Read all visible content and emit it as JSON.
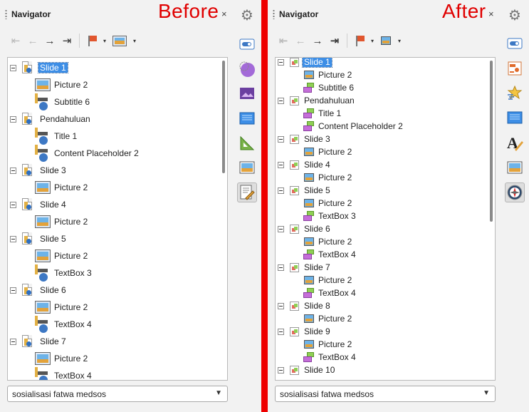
{
  "before": {
    "title": "Navigator",
    "tag": "Before",
    "close": "×",
    "toolbar": {
      "first": "⇤",
      "prev": "←",
      "next": "→",
      "last": "⇥",
      "drop": "▾"
    },
    "tree": [
      {
        "label": "Slide 1",
        "selected": true
      },
      {
        "label": "Picture 2"
      },
      {
        "label": "Subtitle 6"
      },
      {
        "label": "Pendahuluan"
      },
      {
        "label": "Title 1"
      },
      {
        "label": "Content Placeholder 2"
      },
      {
        "label": "Slide 3"
      },
      {
        "label": "Picture 2"
      },
      {
        "label": "Slide 4"
      },
      {
        "label": "Picture 2"
      },
      {
        "label": "Slide 5"
      },
      {
        "label": "Picture 2"
      },
      {
        "label": "TextBox 3"
      },
      {
        "label": "Slide 6"
      },
      {
        "label": "Picture 2"
      },
      {
        "label": "TextBox 4"
      },
      {
        "label": "Slide 7"
      },
      {
        "label": "Picture 2"
      },
      {
        "label": "TextBox 4"
      }
    ],
    "document": "sosialisasi fatwa medsos"
  },
  "after": {
    "title": "Navigator",
    "tag": "After",
    "close": "×",
    "toolbar": {
      "first": "⇤",
      "prev": "←",
      "next": "→",
      "last": "⇥",
      "drop": "▾"
    },
    "tree": [
      {
        "label": "Slide 1",
        "selected": true
      },
      {
        "label": "Picture 2"
      },
      {
        "label": "Subtitle 6"
      },
      {
        "label": "Pendahuluan"
      },
      {
        "label": "Title 1"
      },
      {
        "label": "Content Placeholder 2"
      },
      {
        "label": "Slide 3"
      },
      {
        "label": "Picture 2"
      },
      {
        "label": "Slide 4"
      },
      {
        "label": "Picture 2"
      },
      {
        "label": "Slide 5"
      },
      {
        "label": "Picture 2"
      },
      {
        "label": "TextBox 3"
      },
      {
        "label": "Slide 6"
      },
      {
        "label": "Picture 2"
      },
      {
        "label": "TextBox 4"
      },
      {
        "label": "Slide 7"
      },
      {
        "label": "Picture 2"
      },
      {
        "label": "TextBox 4"
      },
      {
        "label": "Slide 8"
      },
      {
        "label": "Picture 2"
      },
      {
        "label": "Slide 9"
      },
      {
        "label": "Picture 2"
      },
      {
        "label": "TextBox 4"
      },
      {
        "label": "Slide 10"
      }
    ],
    "document": "sosialisasi fatwa medsos"
  },
  "colors": {
    "accent_red": "#ee0000",
    "selection": "#3d8ee6"
  },
  "icons": {
    "before_sidebar": [
      "gear-icon",
      "properties-icon",
      "shapes-icon",
      "gallery-icon",
      "slide-transition-icon",
      "animation-icon",
      "navigator-icon",
      "master-slides-icon"
    ],
    "after_sidebar": [
      "gear-icon",
      "properties-icon",
      "slide-transition-icon",
      "animation-icon",
      "master-slides-icon",
      "styles-icon",
      "gallery-icon",
      "navigator-icon"
    ]
  }
}
